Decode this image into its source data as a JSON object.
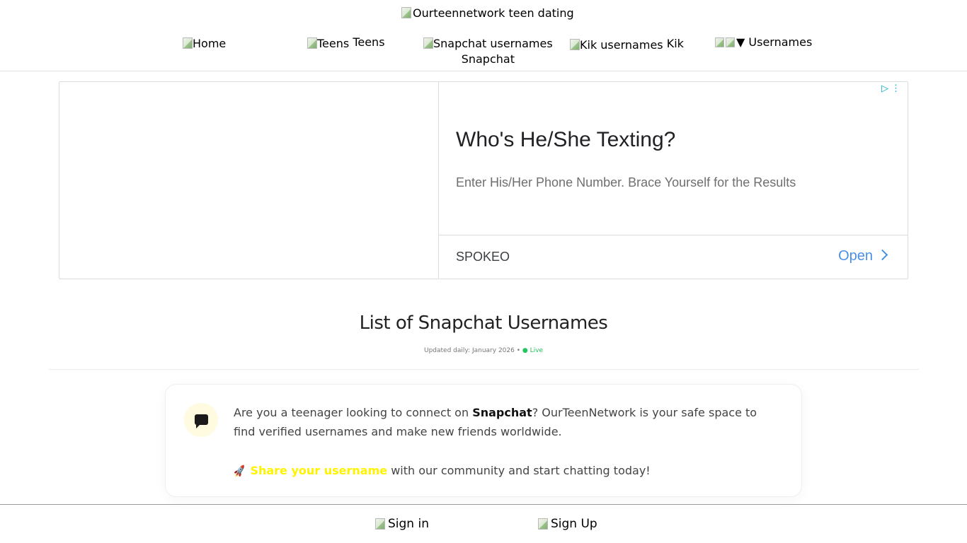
{
  "header": {
    "logo_alt": "Ourteennetwork teen dating",
    "nav": {
      "home_alt": "Home",
      "teens_alt": "Teens",
      "teens_label": "Teens",
      "snapchat_alt": "Snapchat usernames",
      "snapchat_label": "Snapchat",
      "kik_alt": "Kik usernames",
      "kik_label": "Kik",
      "usernames_caret": "▼",
      "usernames_label": "Usernames"
    }
  },
  "ad": {
    "headline": "Who's He/She Texting?",
    "description": "Enter His/Her Phone Number. Brace Yourself for the Results",
    "advertiser": "SPOKEO",
    "cta": "Open",
    "choices_icon": "adchoices-icon"
  },
  "main": {
    "title": "List of Snapchat Usernames",
    "updated_text": "Updated daily: January 2026 •",
    "live_text": "● Live",
    "intro": {
      "icon": "chat-bubble-icon",
      "text_before": "Are you a teenager looking to connect on ",
      "text_bold": "Snapchat",
      "text_after": "? OurTeenNetwork is your safe space to find verified usernames and make new friends worldwide.",
      "cta_icon": "rocket-icon",
      "cta_link": "Share your username",
      "cta_rest": " with our community and start chatting today!"
    }
  },
  "footer": {
    "signin_label": "Sign in",
    "signup_label": "Sign Up"
  },
  "colors": {
    "accent_link": "#fff300",
    "ad_cta": "#4a90e2",
    "live": "#22c55e"
  }
}
